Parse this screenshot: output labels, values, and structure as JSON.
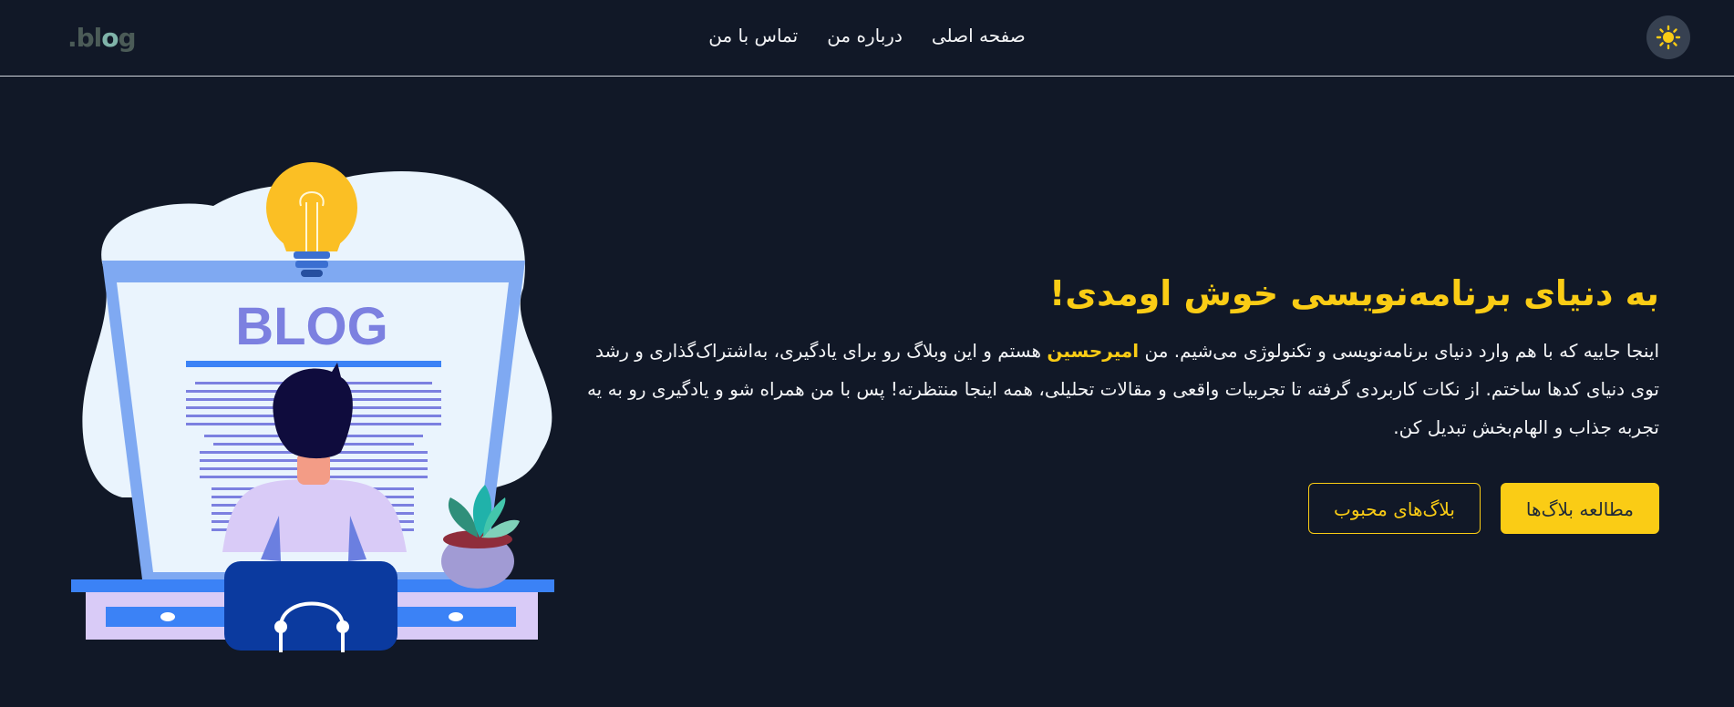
{
  "header": {
    "logo": {
      "pre": ".bl",
      "o": "o",
      "post": "g"
    },
    "nav": [
      {
        "label": "صفحه اصلی"
      },
      {
        "label": "درباره من"
      },
      {
        "label": "تماس با من"
      }
    ],
    "theme_icon": "sun-icon"
  },
  "hero": {
    "title": "به دنیای برنامه‌نویسی خوش اومدی!",
    "para_before_name": "اینجا جاییه که با هم وارد دنیای برنامه‌نویسی و تکنولوژی می‌شیم. من ",
    "name": "امیرحسین",
    "para_after_name": " هستم و این وبلاگ رو برای یادگیری، به‌اشتراک‌گذاری و رشد توی دنیای کدها ساختم. از نکات کاربردی گرفته تا تجربیات واقعی و مقالات تحلیلی، همه اینجا منتظرته! پس با من همراه شو و یادگیری رو به یه تجربه جذاب و الهام‌بخش تبدیل کن.",
    "primary_button": "مطالعه بلاگ‌ها",
    "secondary_button": "بلاگ‌های محبوب"
  },
  "illustration": {
    "screen_text": "BLOG"
  },
  "colors": {
    "background": "#111827",
    "accent": "#facc15"
  }
}
